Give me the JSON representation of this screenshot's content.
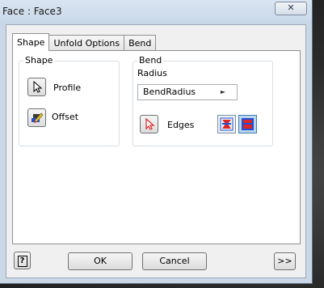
{
  "window": {
    "title": "Face : Face3",
    "close_glyph": "✕"
  },
  "tabs": [
    {
      "label": "Shape",
      "active": true
    },
    {
      "label": "Unfold Options",
      "active": false
    },
    {
      "label": "Bend",
      "active": false
    }
  ],
  "shape_group": {
    "label": "Shape",
    "profile_label": "Profile",
    "offset_label": "Offset",
    "profile_icon": "select-arrow-icon",
    "offset_icon": "offset-pencil-icon"
  },
  "bend_group": {
    "label": "Bend",
    "radius_label": "Radius",
    "radius_value": "BendRadius",
    "edges_label": "Edges",
    "edges_icon": "select-arrow-red-icon",
    "toggle_icons": [
      "edge-type-1-icon",
      "edge-type-2-icon"
    ]
  },
  "footer": {
    "help_glyph": "?",
    "ok_label": "OK",
    "cancel_label": "Cancel",
    "more_label": ">>"
  },
  "colors": {
    "frame": "#c9d7e6",
    "panel": "#ffffff",
    "selection_arrow_red": "#d8262a"
  }
}
